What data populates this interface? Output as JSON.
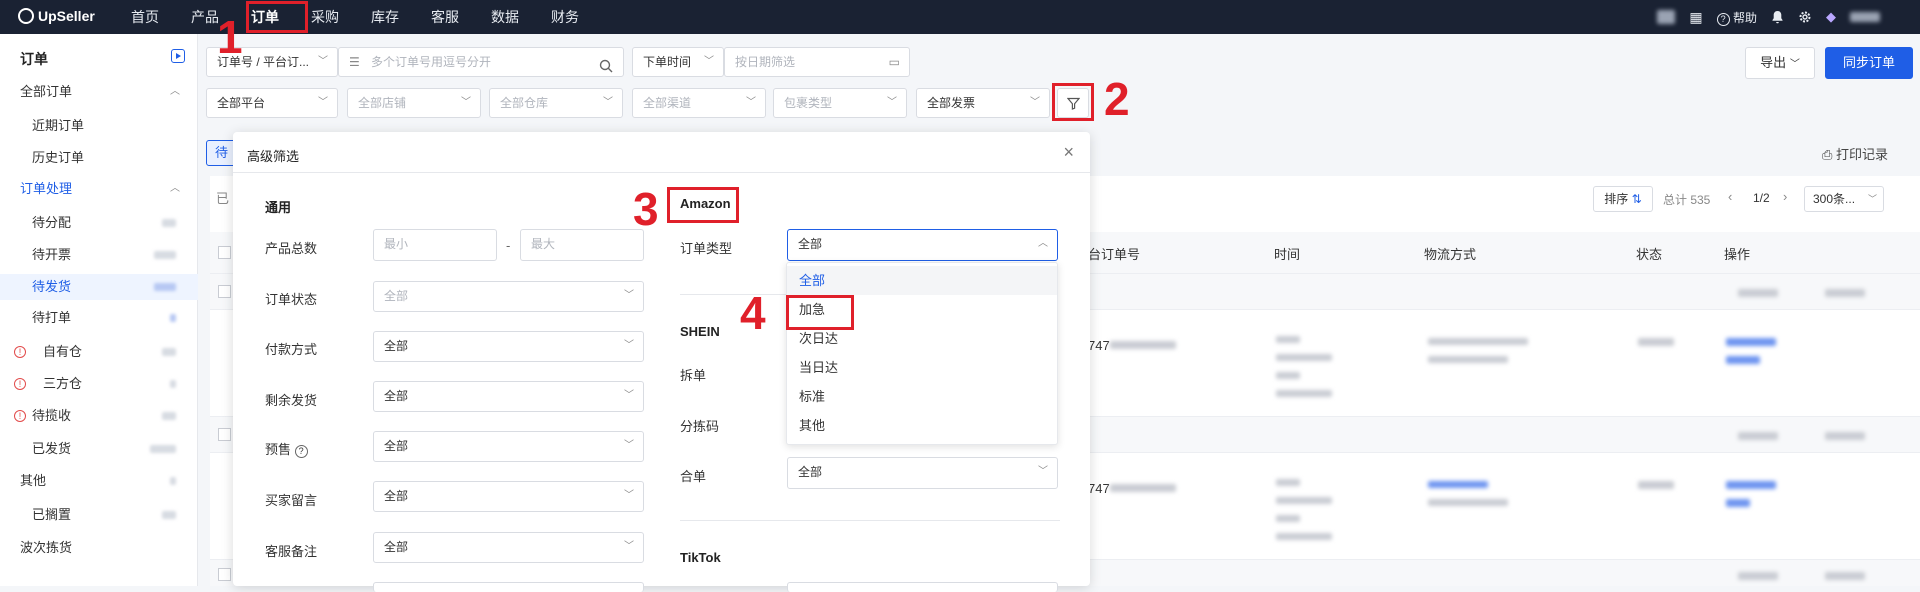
{
  "app": {
    "name": "UpSeller"
  },
  "nav": {
    "items": [
      "首页",
      "产品",
      "订单",
      "采购",
      "库存",
      "客服",
      "数据",
      "财务"
    ],
    "active_index": 2
  },
  "topbar_right": {
    "help": "帮助"
  },
  "sidebar": {
    "title": "订单",
    "items": [
      {
        "label": "全部订单",
        "kind": "group"
      },
      {
        "label": "近期订单",
        "kind": "sub"
      },
      {
        "label": "历史订单",
        "kind": "sub"
      },
      {
        "label": "订单处理",
        "kind": "group-active"
      },
      {
        "label": "待分配",
        "kind": "sub"
      },
      {
        "label": "待开票",
        "kind": "sub"
      },
      {
        "label": "待发货",
        "kind": "sub-active"
      },
      {
        "label": "待打单",
        "kind": "sub"
      },
      {
        "label": "自有仓",
        "kind": "warn"
      },
      {
        "label": "三方仓",
        "kind": "warn"
      },
      {
        "label": "待揽收",
        "kind": "warn"
      },
      {
        "label": "已发货",
        "kind": "sub"
      },
      {
        "label": "其他",
        "kind": "group"
      },
      {
        "label": "已搁置",
        "kind": "sub"
      },
      {
        "label": "波次拣货",
        "kind": "group"
      }
    ]
  },
  "filters": {
    "search_type": "订单号 / 平台订...",
    "search_placeholder": "多个订单号用逗号分开",
    "time_type": "下单时间",
    "date_placeholder": "按日期筛选",
    "platform": "全部平台",
    "store": "全部店铺",
    "warehouse": "全部仓库",
    "channel": "全部渠道",
    "package_type": "包裹类型",
    "invoice": "全部发票"
  },
  "toolbar": {
    "export": "导出",
    "sync": "同步订单",
    "print_log": "打印记录",
    "sort": "排序",
    "total": "总计 535",
    "page": "1/2",
    "page_size": "300条..."
  },
  "tab_partial": "待",
  "status_partial": "已",
  "table": {
    "headers": [
      "台订单号",
      "时间",
      "物流方式",
      "状态",
      "操作"
    ],
    "order_prefix_1": "747",
    "order_prefix_2": "747"
  },
  "panel": {
    "title": "高级筛选",
    "general": {
      "section": "通用",
      "rows": [
        {
          "label": "产品总数",
          "min_placeholder": "最小",
          "max_placeholder": "最大",
          "sep": "-"
        },
        {
          "label": "订单状态",
          "value": "全部"
        },
        {
          "label": "付款方式",
          "value": "全部"
        },
        {
          "label": "剩余发货",
          "value": "全部"
        },
        {
          "label": "预售",
          "value": "全部"
        },
        {
          "label": "买家留言",
          "value": "全部"
        },
        {
          "label": "客服备注",
          "value": "全部"
        }
      ]
    },
    "amazon": {
      "section": "Amazon",
      "order_type_label": "订单类型",
      "order_type_value": "全部"
    },
    "shein": {
      "section": "SHEIN",
      "split_label": "拆单",
      "sort_code_label": "分拣码",
      "merge_label": "合单",
      "merge_value": "全部"
    },
    "tiktok": {
      "section": "TikTok"
    },
    "dropdown_options": [
      "全部",
      "加急",
      "次日达",
      "当日达",
      "标准",
      "其他"
    ]
  },
  "annotations": [
    "1",
    "2",
    "3",
    "4"
  ],
  "colors": {
    "primary": "#1f5ee6",
    "topbar": "#1a2233",
    "annotation": "#e0202a"
  }
}
